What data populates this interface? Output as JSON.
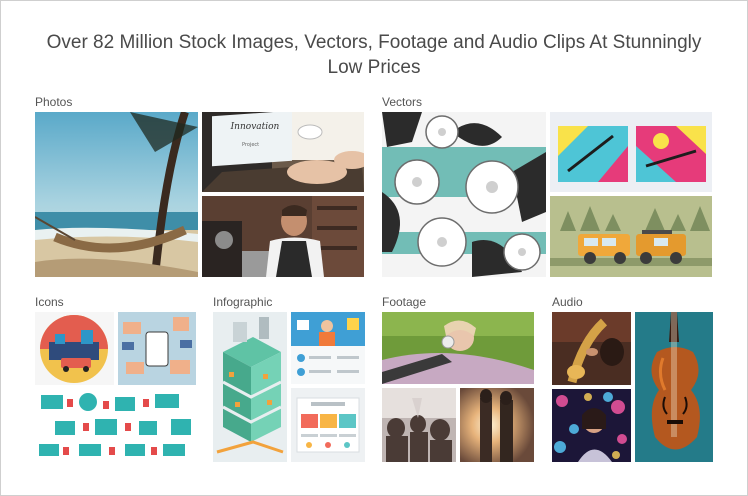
{
  "headline": "Over 82 Million Stock Images, Vectors, Footage and Audio Clips At Stunningly Low Prices",
  "categories": {
    "photos": "Photos",
    "vectors": "Vectors",
    "icons": "Icons",
    "infographic": "Infographic",
    "footage": "Footage",
    "audio": "Audio"
  },
  "tile_text": {
    "innovation": "Innovation",
    "project": "Project"
  }
}
